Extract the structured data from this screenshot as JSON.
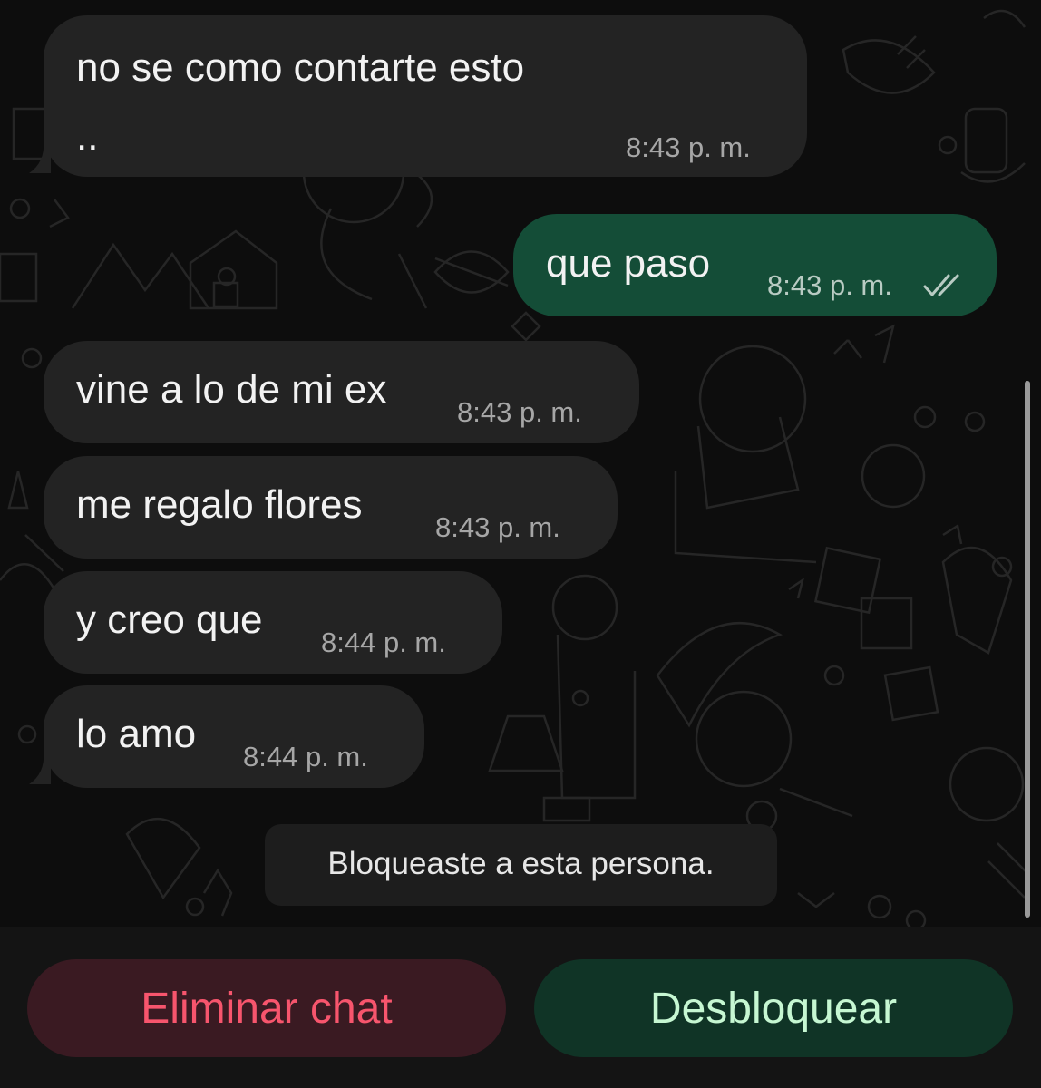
{
  "messages": [
    {
      "direction": "in",
      "text_lines": [
        "no se como contarte esto",
        ".."
      ],
      "time": "8:43 p. m."
    },
    {
      "direction": "out",
      "text": "que paso",
      "time": "8:43 p. m.",
      "status_icon": "double-check-icon"
    },
    {
      "direction": "in",
      "text": "vine a lo de mi ex",
      "time": "8:43 p. m."
    },
    {
      "direction": "in",
      "text": "me regalo flores",
      "time": "8:43 p. m."
    },
    {
      "direction": "in",
      "text": "y creo que",
      "time": "8:44 p. m."
    },
    {
      "direction": "in",
      "text": "lo amo",
      "time": "8:44 p. m."
    }
  ],
  "system_notice": "Bloqueaste a esta persona.",
  "actions": {
    "delete_label": "Eliminar chat",
    "unblock_label": "Desbloquear"
  },
  "colors": {
    "incoming_bubble": "#232323",
    "outgoing_bubble": "#144d37",
    "delete_text": "#f7556d",
    "unblock_text": "#c6f7d2"
  }
}
